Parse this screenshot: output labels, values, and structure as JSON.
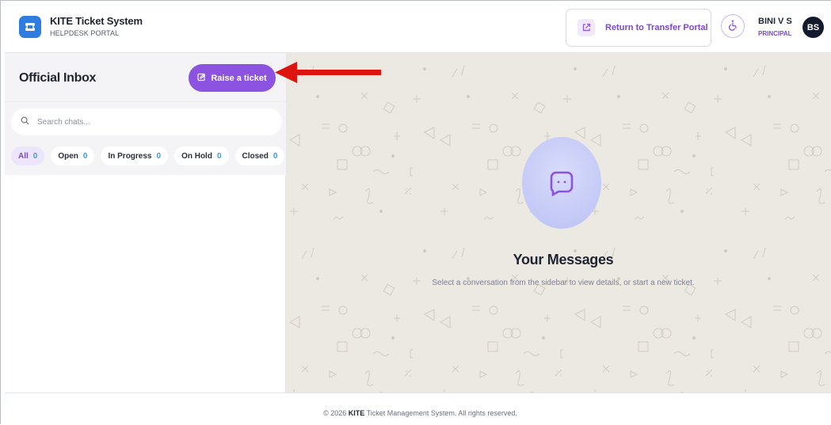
{
  "header": {
    "app_title": "KITE Ticket System",
    "app_subtitle": "HELPDESK PORTAL",
    "return_label": "Return to Transfer Portal",
    "user_name": "BINI V S",
    "user_role": "PRINCIPAL",
    "avatar_initials": "BS"
  },
  "sidebar": {
    "title": "Official Inbox",
    "raise_label": "Raise a ticket",
    "search_placeholder": "Search chats...",
    "tabs": [
      {
        "label": "All",
        "count": "0"
      },
      {
        "label": "Open",
        "count": "0"
      },
      {
        "label": "In Progress",
        "count": "0"
      },
      {
        "label": "On Hold",
        "count": "0"
      },
      {
        "label": "Closed",
        "count": "0"
      }
    ]
  },
  "main": {
    "empty_title": "Your Messages",
    "empty_subtitle": "Select a conversation from the sidebar to view details, or start a new ticket."
  },
  "footer": {
    "prefix": "© 2026 ",
    "brand": "KITE",
    "suffix": " Ticket Management System. All rights reserved."
  },
  "colors": {
    "accent": "#8c52e0",
    "brand_blue": "#2f7de1",
    "count_blue": "#3f9ae0",
    "annotation_red": "#e0140f"
  },
  "icons": [
    "ticket-logo-icon",
    "external-link-icon",
    "accessibility-icon",
    "edit-square-icon",
    "search-icon",
    "chat-bubble-icon"
  ]
}
